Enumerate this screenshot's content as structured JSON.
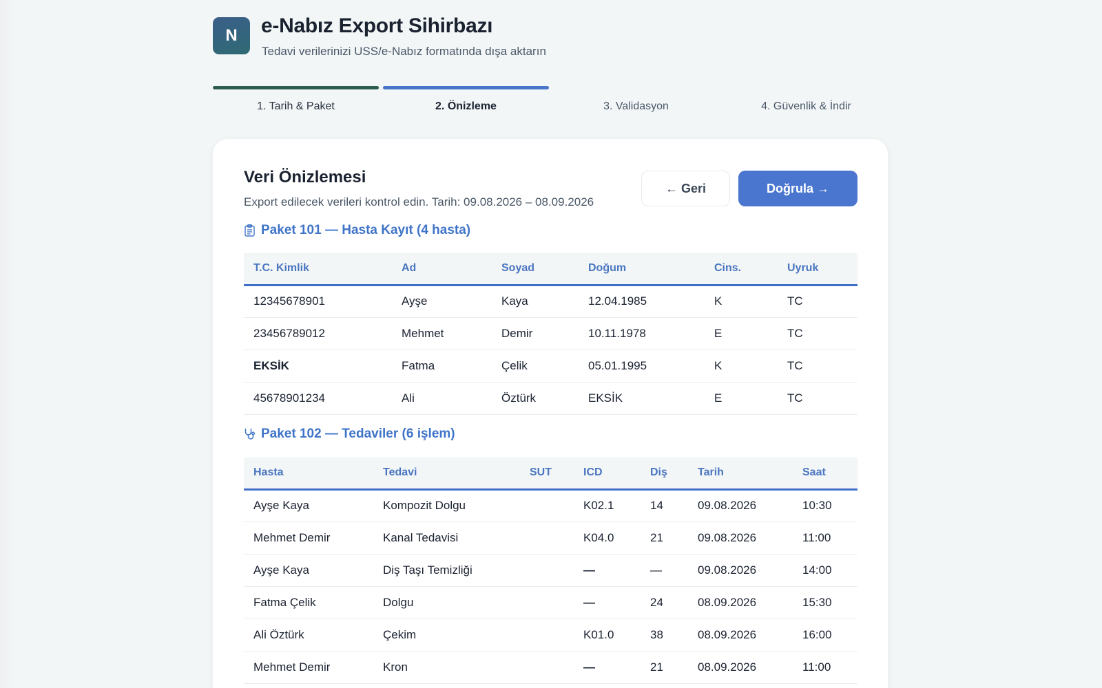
{
  "header": {
    "logo_letter": "N",
    "title": "e-Nabız Export Sihirbazı",
    "subtitle": "Tedavi verilerinizi USS/e-Nabız formatında dışa aktarın"
  },
  "steps": [
    {
      "label": "1. Tarih & Paket",
      "state": "done"
    },
    {
      "label": "2. Önizleme",
      "state": "active"
    },
    {
      "label": "3. Validasyon",
      "state": "pending"
    },
    {
      "label": "4. Güvenlik & İndir",
      "state": "pending"
    }
  ],
  "card": {
    "title": "Veri Önizlemesi",
    "subtitle": "Export edilecek verileri kontrol edin. Tarih: 09.08.2026 – 08.09.2026",
    "back_label": "← Geri",
    "next_label": "Doğrula →"
  },
  "package101": {
    "title": "Paket 101 — Hasta Kayıt (4 hasta)",
    "icon": "clipboard-icon",
    "columns": [
      "T.C. Kimlik",
      "Ad",
      "Soyad",
      "Doğum",
      "Cins.",
      "Uyruk"
    ],
    "rows": [
      [
        "12345678901",
        "Ayşe",
        "Kaya",
        "12.04.1985",
        "K",
        "TC"
      ],
      [
        "23456789012",
        "Mehmet",
        "Demir",
        "10.11.1978",
        "E",
        "TC"
      ],
      [
        "EKSİK",
        "Fatma",
        "Çelik",
        "05.01.1995",
        "K",
        "TC"
      ],
      [
        "45678901234",
        "Ali",
        "Öztürk",
        "EKSİK",
        "E",
        "TC"
      ]
    ]
  },
  "package102": {
    "title": "Paket 102 — Tedaviler (6 işlem)",
    "icon": "stethoscope-icon",
    "columns": [
      "Hasta",
      "Tedavi",
      "SUT",
      "ICD",
      "Diş",
      "Tarih",
      "Saat"
    ],
    "rows": [
      [
        "Ayşe Kaya",
        "Kompozit Dolgu",
        "",
        "K02.1",
        "14",
        "09.08.2026",
        "10:30"
      ],
      [
        "Mehmet Demir",
        "Kanal Tedavisi",
        "",
        "K04.0",
        "21",
        "09.08.2026",
        "11:00"
      ],
      [
        "Ayşe Kaya",
        "Diş Taşı Temizliği",
        "",
        "—",
        "—",
        "09.08.2026",
        "14:00"
      ],
      [
        "Fatma Çelik",
        "Dolgu",
        "",
        "—",
        "24",
        "08.09.2026",
        "15:30"
      ],
      [
        "Ali Öztürk",
        "Çekim",
        "",
        "K01.0",
        "38",
        "08.09.2026",
        "16:00"
      ],
      [
        "Mehmet Demir",
        "Kron",
        "",
        "—",
        "21",
        "08.09.2026",
        "11:00"
      ]
    ]
  },
  "colors": {
    "accent": "#4a76d0",
    "step_done": "#2e5d4e",
    "missing": "#b02a2a",
    "dash_warning": "#b8902a"
  }
}
